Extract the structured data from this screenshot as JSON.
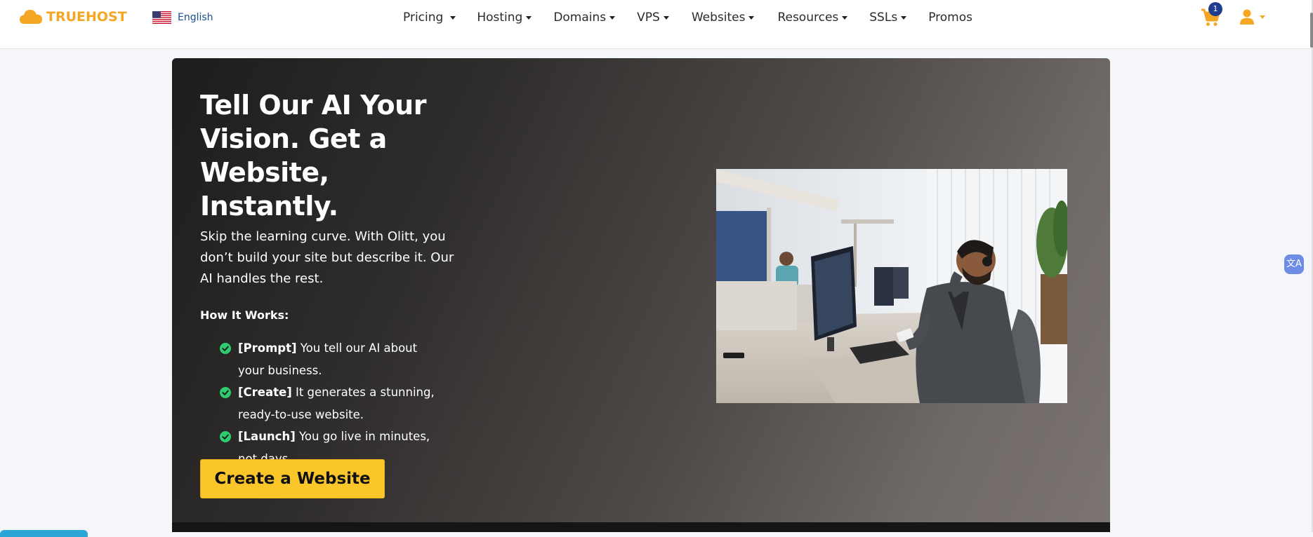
{
  "brand": {
    "name": "TRUEHOST",
    "accent": "#f5a623"
  },
  "language": {
    "label": "English",
    "flag_icon": "us-flag-icon"
  },
  "nav": {
    "items": [
      {
        "label": "Pricing",
        "dropdown": true
      },
      {
        "label": "Hosting",
        "dropdown": true
      },
      {
        "label": "Domains",
        "dropdown": true
      },
      {
        "label": "VPS",
        "dropdown": true
      },
      {
        "label": "Websites",
        "dropdown": true
      },
      {
        "label": "Resources",
        "dropdown": true
      },
      {
        "label": "SSLs",
        "dropdown": true
      },
      {
        "label": "Promos",
        "dropdown": false
      }
    ]
  },
  "cart": {
    "count": "1",
    "icon": "cart-icon",
    "badge_color": "#1e3d8f"
  },
  "user_menu": {
    "icon": "user-icon"
  },
  "translate_widget": {
    "label": "文A",
    "icon": "translate-icon"
  },
  "hero": {
    "title": "Tell Our AI Your Vision. Get a Website, Instantly.",
    "description": "Skip the learning curve. With Olitt, you don’t build your site but describe it. Our AI handles the rest.",
    "how_title": "How It Works:",
    "steps": [
      {
        "tag": "[Prompt]",
        "text": " You tell our AI about your business."
      },
      {
        "tag": "[Create]",
        "text": " It generates a stunning, ready-to-use website."
      },
      {
        "tag": "[Launch]",
        "text": " You go live in minutes, not days."
      }
    ],
    "cta_label": "Create a Website",
    "cta_color": "#fbc629",
    "check_color": "#2ecc71",
    "image_icon": "office-illustration"
  }
}
